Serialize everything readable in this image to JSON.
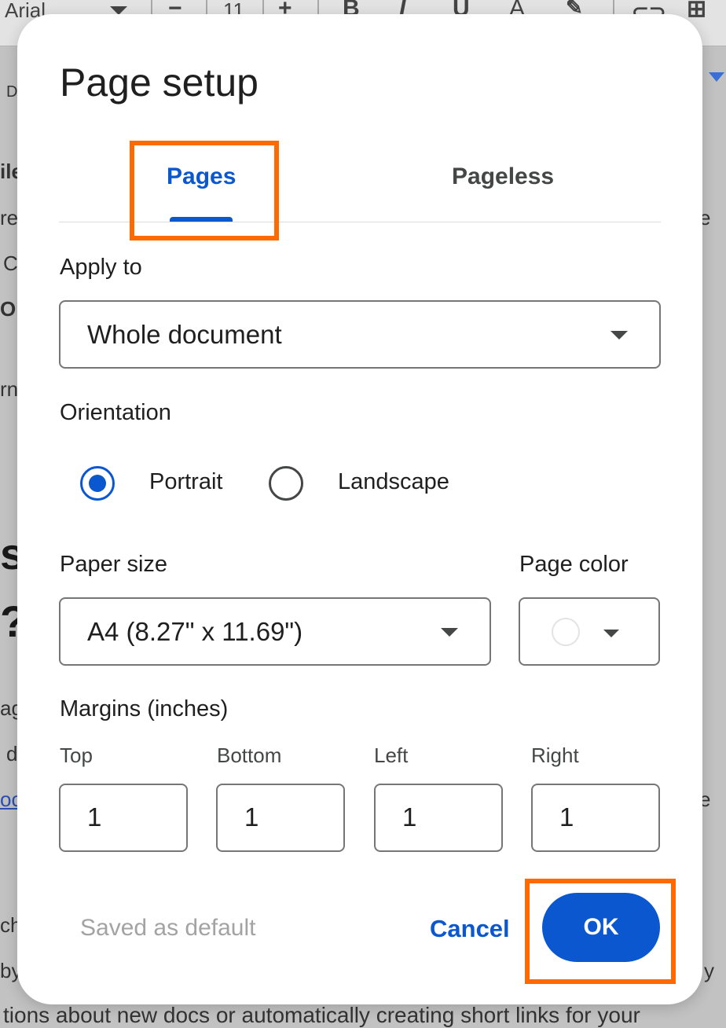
{
  "background": {
    "font_name": "Arial",
    "font_size": "11",
    "toolbar_glyphs": [
      "−",
      "+",
      "B",
      "I",
      "U",
      "A"
    ],
    "fragments": [
      "D",
      "ile",
      "re",
      "C",
      "OK",
      "rn",
      "s",
      "?",
      "ag",
      "d",
      "oc",
      "e",
      "e",
      "ch",
      "by",
      "y"
    ],
    "bottom_line": "tions about new docs or automatically creating short links for your"
  },
  "dialog": {
    "title": "Page setup",
    "tabs": [
      {
        "label": "Pages",
        "selected": true
      },
      {
        "label": "Pageless",
        "selected": false
      }
    ],
    "apply_to": {
      "label": "Apply to",
      "value": "Whole document"
    },
    "orientation": {
      "label": "Orientation",
      "options": [
        {
          "label": "Portrait",
          "selected": true
        },
        {
          "label": "Landscape",
          "selected": false
        }
      ]
    },
    "paper_size": {
      "label": "Paper size",
      "value": "A4 (8.27\" x 11.69\")"
    },
    "page_color": {
      "label": "Page color",
      "value": "#ffffff"
    },
    "margins": {
      "label": "Margins (inches)",
      "fields": [
        {
          "label": "Top",
          "value": "1"
        },
        {
          "label": "Bottom",
          "value": "1"
        },
        {
          "label": "Left",
          "value": "1"
        },
        {
          "label": "Right",
          "value": "1"
        }
      ]
    },
    "footer": {
      "saved_default": "Saved as default",
      "cancel": "Cancel",
      "ok": "OK"
    }
  },
  "colors": {
    "accent": "#0b57d0",
    "annotation": "#ff6a00"
  }
}
